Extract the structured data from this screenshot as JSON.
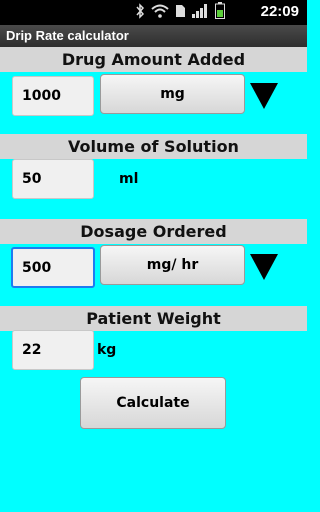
{
  "status_bar": {
    "time": "22:09",
    "icons": [
      "bluetooth-icon",
      "wifi-icon",
      "sd-card-icon",
      "signal-icon",
      "battery-icon"
    ]
  },
  "app": {
    "title": "Drip Rate calculator"
  },
  "drug_amount": {
    "header": "Drug Amount Added",
    "value": "1000",
    "unit": "mg"
  },
  "volume": {
    "header": "Volume of Solution",
    "value": "50",
    "unit": "ml"
  },
  "dosage": {
    "header": "Dosage Ordered",
    "value": "500",
    "unit": "mg/ hr"
  },
  "weight": {
    "header": "Patient Weight",
    "value": "22",
    "unit": "kg"
  },
  "calculate_label": "Calculate",
  "colors": {
    "background": "#00ffff",
    "section_header": "#d6d6d6",
    "focus": "#1f7bf0"
  }
}
